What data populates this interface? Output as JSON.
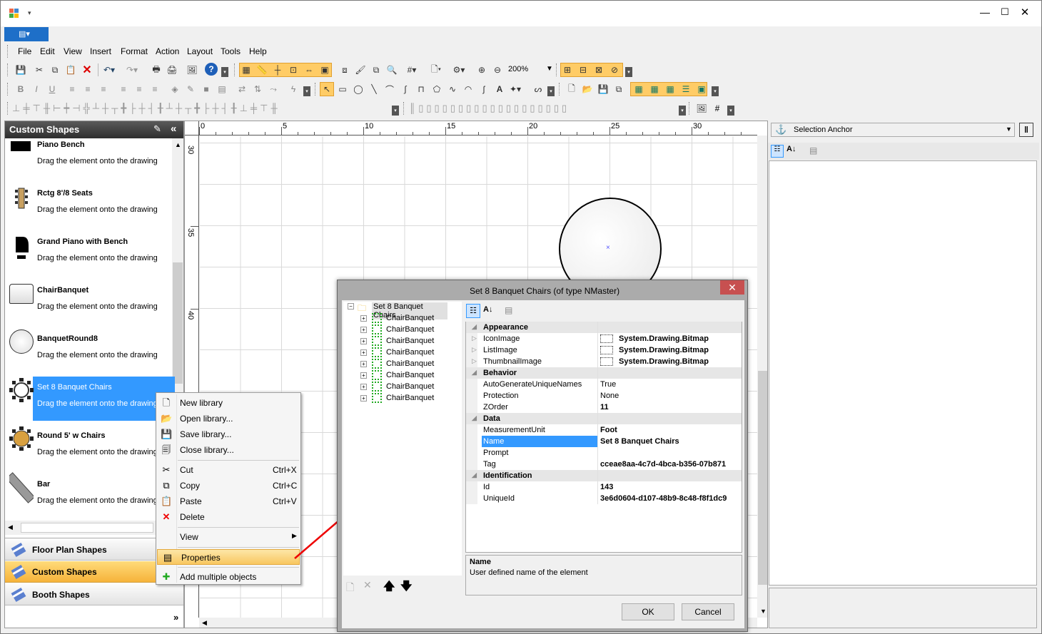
{
  "menu": [
    "File",
    "Edit",
    "View",
    "Insert",
    "Format",
    "Action",
    "Layout",
    "Tools",
    "Help"
  ],
  "toolbar": {
    "zoom_value": "200%"
  },
  "panel": {
    "title": "Custom Shapes",
    "shapes": [
      {
        "name": "Piano Bench",
        "desc": "Drag the element onto the drawing"
      },
      {
        "name": "Rctg 8'/8 Seats",
        "desc": "Drag the element onto the drawing"
      },
      {
        "name": "Grand Piano with Bench",
        "desc": "Drag the element onto the drawing"
      },
      {
        "name": "ChairBanquet",
        "desc": "Drag the element onto the drawing"
      },
      {
        "name": "BanquetRound8",
        "desc": "Drag the element onto the drawing"
      },
      {
        "name": "Set 8 Banquet Chairs",
        "desc": "Drag the element onto the drawing"
      },
      {
        "name": "Round 5' w Chairs",
        "desc": "Drag the element onto the drawing"
      },
      {
        "name": "Bar",
        "desc": "Drag the element onto the drawing"
      }
    ],
    "groups": [
      "Floor Plan Shapes",
      "Custom Shapes",
      "Booth Shapes"
    ],
    "more": "»"
  },
  "context_menu": [
    {
      "label": "New library",
      "shortcut": "",
      "icon": "new-library-icon"
    },
    {
      "label": "Open library...",
      "shortcut": "",
      "icon": "open-folder-icon"
    },
    {
      "label": "Save library...",
      "shortcut": "",
      "icon": "save-icon"
    },
    {
      "label": "Close library...",
      "shortcut": "",
      "icon": "close-library-icon"
    },
    {
      "label": "Cut",
      "shortcut": "Ctrl+X",
      "icon": "cut-icon"
    },
    {
      "label": "Copy",
      "shortcut": "Ctrl+C",
      "icon": "copy-icon"
    },
    {
      "label": "Paste",
      "shortcut": "Ctrl+V",
      "icon": "paste-icon"
    },
    {
      "label": "Delete",
      "shortcut": "",
      "icon": "delete-icon"
    },
    {
      "label": "View",
      "shortcut": "",
      "icon": ""
    },
    {
      "label": "Properties",
      "shortcut": "",
      "icon": "properties-icon"
    },
    {
      "label": "Add multiple objects",
      "shortcut": "",
      "icon": "add-objects-icon"
    }
  ],
  "ruler": {
    "h_labels": [
      "0",
      "5",
      "10",
      "15",
      "20",
      "25",
      "30"
    ],
    "v_labels": [
      "30",
      "35",
      "40"
    ]
  },
  "right_panel": {
    "selector_value": "Selection Anchor"
  },
  "dialog": {
    "title": "Set 8 Banquet Chairs (of type NMaster)",
    "tree_root": "Set 8 Banquet Chairs",
    "tree_children": [
      "ChairBanquet",
      "ChairBanquet",
      "ChairBanquet",
      "ChairBanquet",
      "ChairBanquet",
      "ChairBanquet",
      "ChairBanquet",
      "ChairBanquet"
    ],
    "categories": {
      "appearance": "Appearance",
      "behavior": "Behavior",
      "data": "Data",
      "identification": "Identification"
    },
    "props": {
      "iconimage": {
        "k": "IconImage",
        "v": "System.Drawing.Bitmap"
      },
      "listimage": {
        "k": "ListImage",
        "v": "System.Drawing.Bitmap"
      },
      "thumbnailimage": {
        "k": "ThumbnailImage",
        "v": "System.Drawing.Bitmap"
      },
      "autogen": {
        "k": "AutoGenerateUniqueNames",
        "v": "True"
      },
      "protection": {
        "k": "Protection",
        "v": "None"
      },
      "zorder": {
        "k": "ZOrder",
        "v": "11"
      },
      "measurement": {
        "k": "MeasurementUnit",
        "v": "Foot"
      },
      "name": {
        "k": "Name",
        "v": "Set 8 Banquet Chairs"
      },
      "prompt": {
        "k": "Prompt",
        "v": ""
      },
      "tag": {
        "k": "Tag",
        "v": "cceae8aa-4c7d-4bca-b356-07b871"
      },
      "id": {
        "k": "Id",
        "v": "143"
      },
      "uniqueid": {
        "k": "UniqueId",
        "v": "3e6d0604-d107-48b9-8c48-f8f1dc9"
      }
    },
    "help_title": "Name",
    "help_text": "User defined name of the element",
    "ok": "OK",
    "cancel": "Cancel"
  }
}
